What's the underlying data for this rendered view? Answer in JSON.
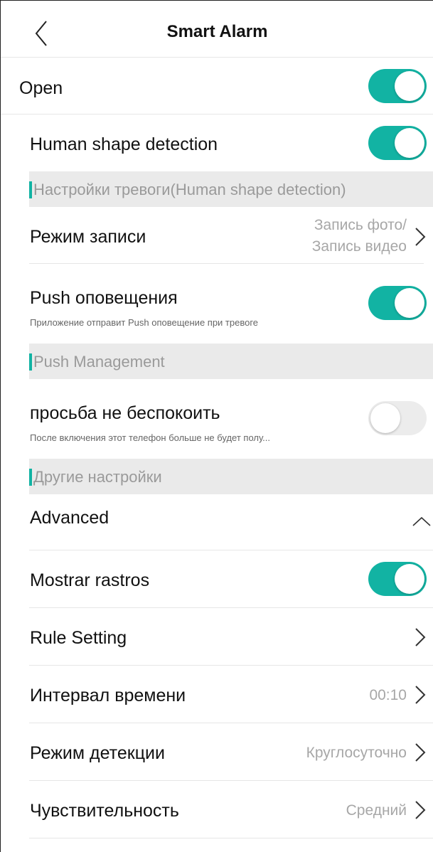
{
  "header": {
    "title": "Smart Alarm",
    "back_icon": "chevron-left-icon"
  },
  "open": {
    "label": "Open",
    "toggle": true
  },
  "human_shape": {
    "label": "Human shape detection",
    "toggle": true
  },
  "sections": {
    "alarm_settings": "Настройки тревоги(Human shape detection)",
    "push_management": "Push Management",
    "other_settings": "Другие настройки"
  },
  "record_mode": {
    "label": "Режим записи",
    "value_line1": "Запись фото/",
    "value_line2": "Запись видео"
  },
  "push": {
    "label": "Push оповещения",
    "sub": "Приложение отправит Push оповещение при тревоге",
    "toggle": true
  },
  "dnd": {
    "label": "просьба не беспокоить",
    "sub": "После включения этот телефон больше не будет полу...",
    "toggle": false
  },
  "advanced": {
    "label": "Advanced",
    "expanded": true
  },
  "show_traces": {
    "label": "Mostrar rastros",
    "toggle": true
  },
  "rule_setting": {
    "label": "Rule Setting"
  },
  "time_interval": {
    "label": "Интервал времени",
    "value": "00:10"
  },
  "detect_mode": {
    "label": "Режим детекции",
    "value": "Круглосуточно"
  },
  "sensitivity": {
    "label": "Чувствительность",
    "value": "Средний"
  },
  "colors": {
    "accent": "#12b3a3",
    "toggle_off": "#ececec",
    "section_bg": "#eaeaea",
    "muted_text": "#a7a7a7"
  }
}
